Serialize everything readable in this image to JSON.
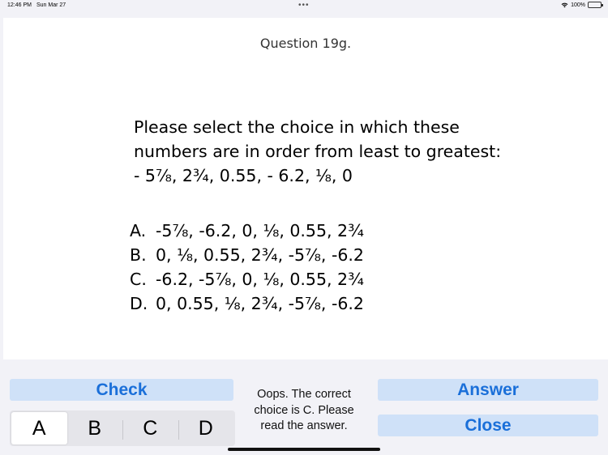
{
  "status_bar": {
    "time": "12:46 PM",
    "date": "Sun Mar 27",
    "dots": "•••",
    "battery": "100%"
  },
  "question": {
    "title": "Question 19g.",
    "prompt_lines": [
      "Please select the choice in which these",
      "numbers are in order from least to greatest:",
      "- 5⅞, 2¾, 0.55, - 6.2, ⅛, 0"
    ],
    "choices": [
      {
        "letter": "A.",
        "text": "-5⅞, -6.2, 0, ⅛, 0.55, 2¾"
      },
      {
        "letter": "B.",
        "text": "0, ⅛, 0.55, 2¾, -5⅞, -6.2"
      },
      {
        "letter": "C.",
        "text": "-6.2, -5⅞, 0, ⅛, 0.55, 2¾"
      },
      {
        "letter": "D.",
        "text": "0, 0.55, ⅛, 2¾, -5⅞, -6.2"
      }
    ]
  },
  "controls": {
    "check_label": "Check",
    "answer_label": "Answer",
    "close_label": "Close",
    "segments": [
      "A",
      "B",
      "C",
      "D"
    ],
    "selected_segment": "A",
    "feedback": "Oops. The correct choice is C. Please read the answer."
  },
  "colors": {
    "button_bg": "#cfe1f8",
    "button_text": "#1a6fd9",
    "panel_bg": "#f2f2f7"
  }
}
